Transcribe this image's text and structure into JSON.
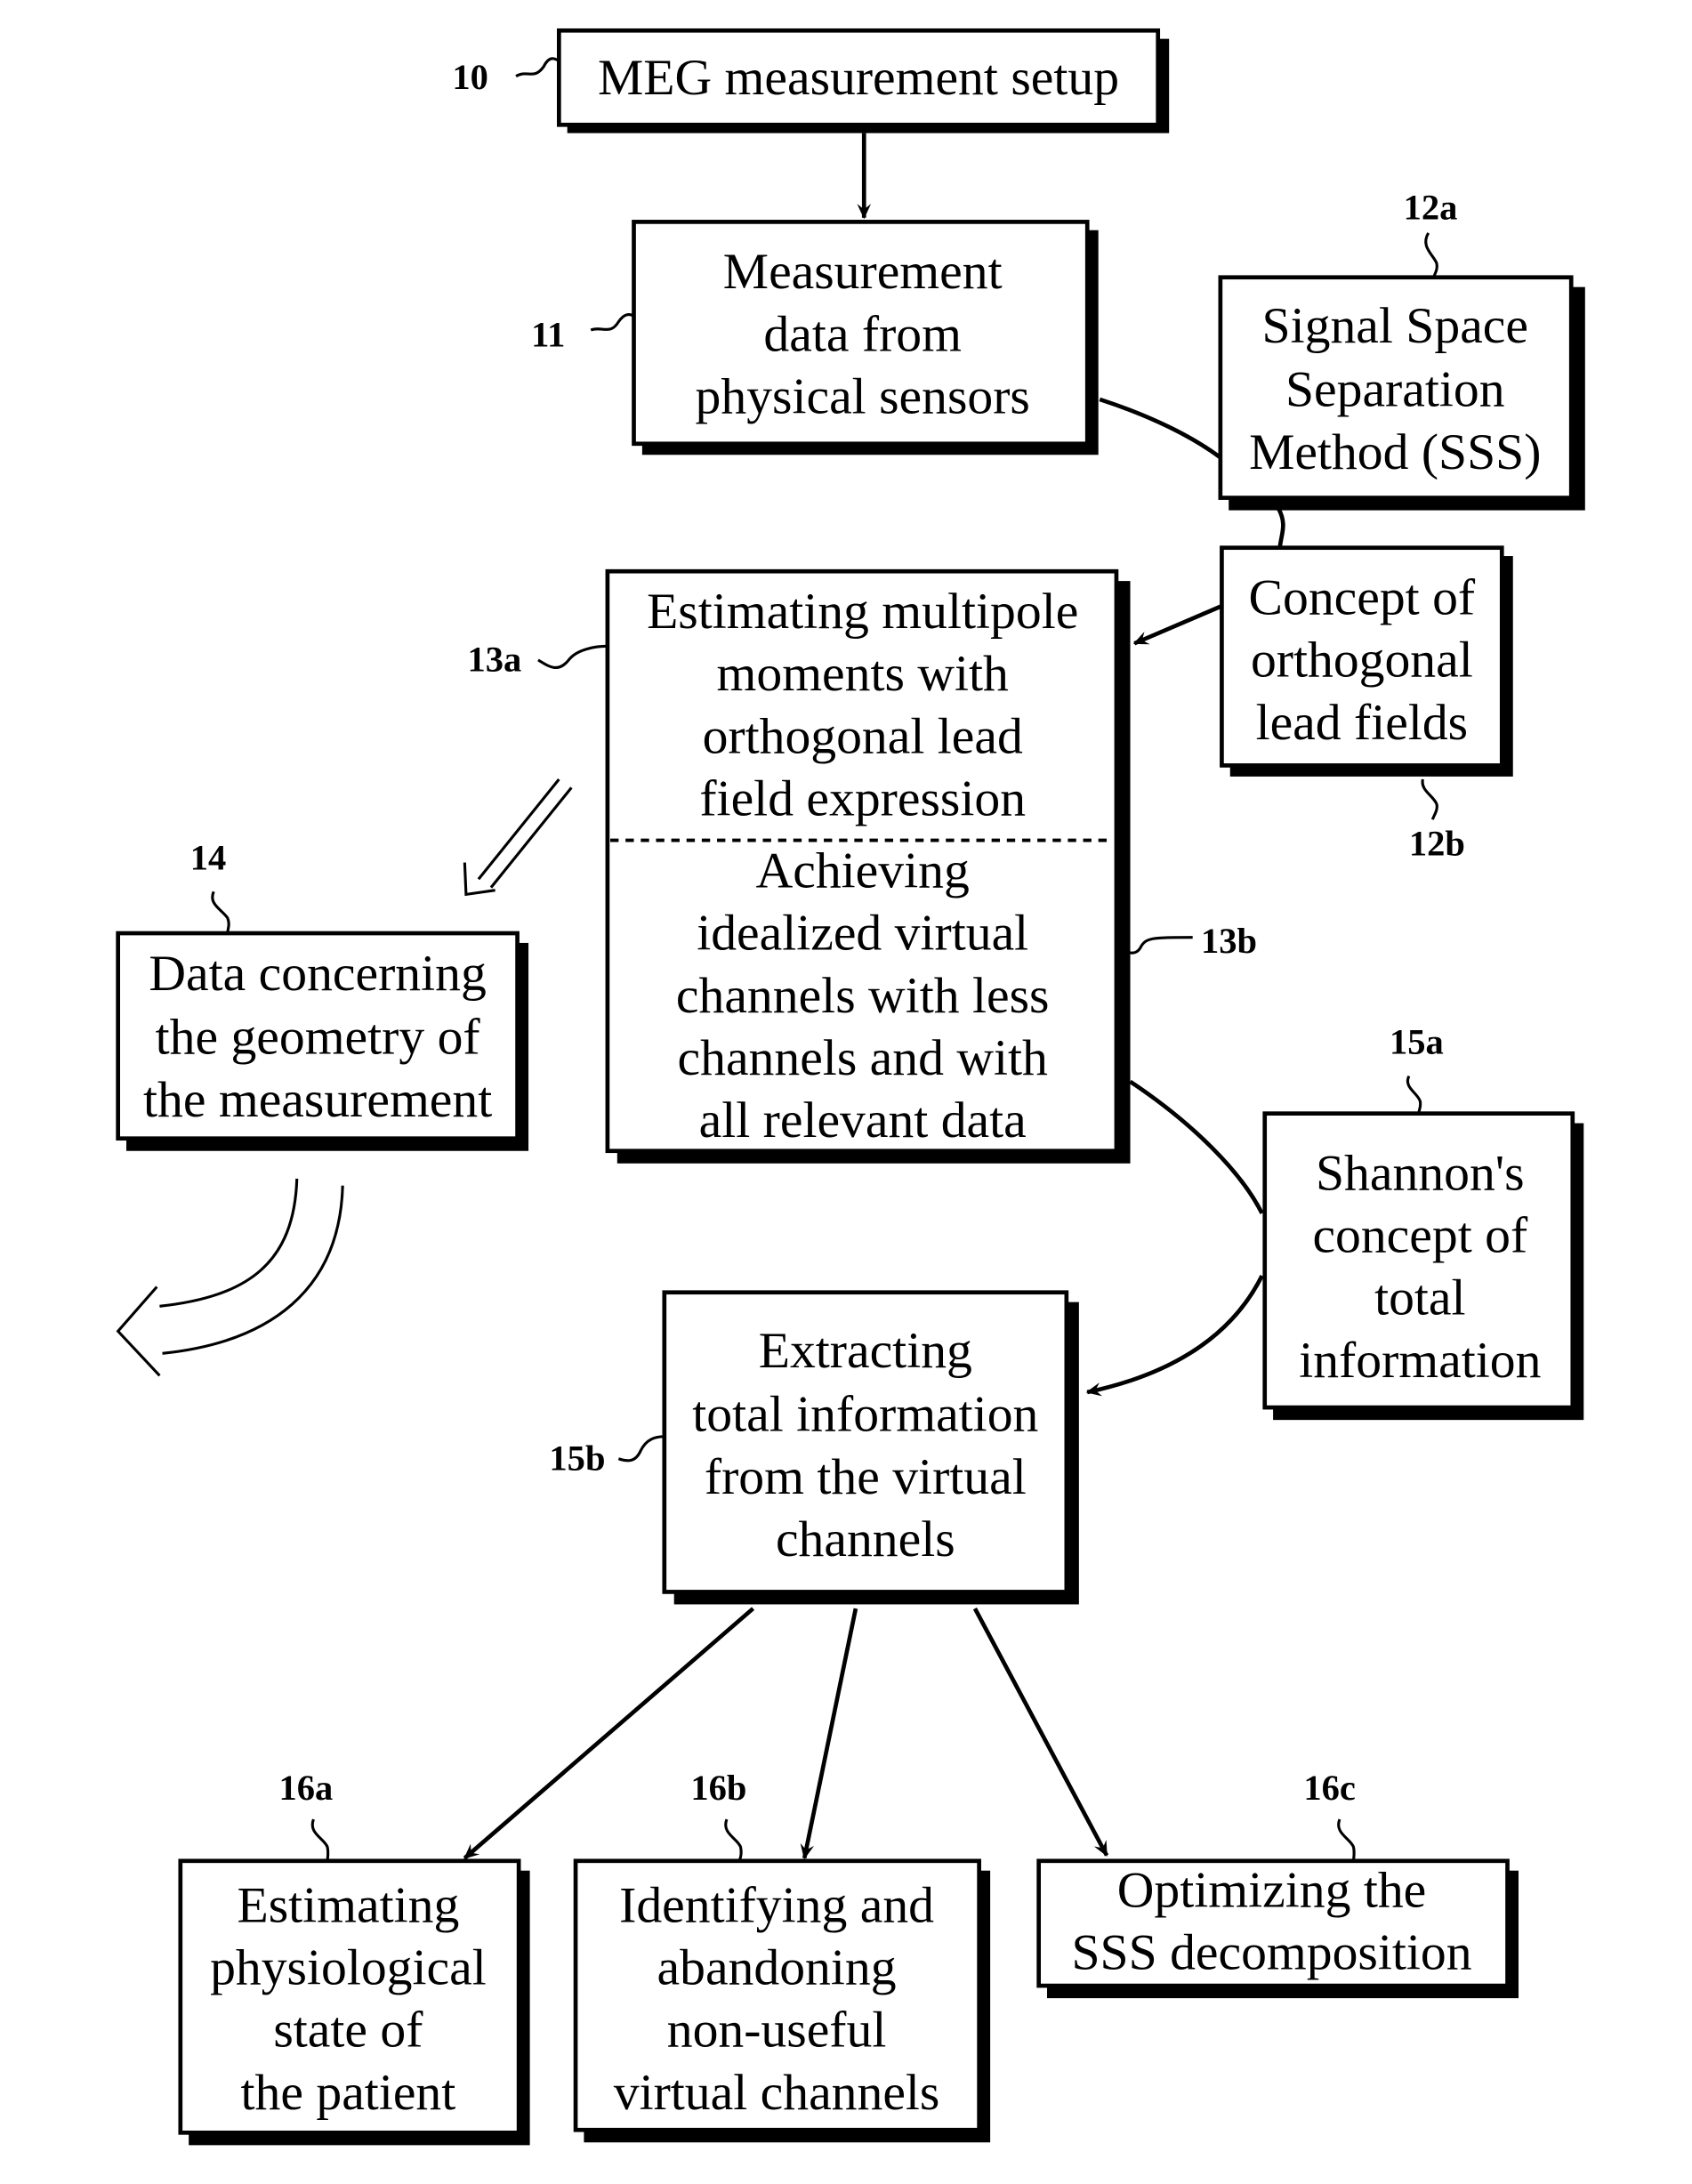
{
  "diagram": {
    "nodes": {
      "n10": {
        "ref": "10",
        "lines": [
          "MEG measurement setup"
        ]
      },
      "n11": {
        "ref": "11",
        "lines": [
          "Measurement",
          "data from",
          "physical sensors"
        ]
      },
      "n12a": {
        "ref": "12a",
        "lines": [
          "Signal Space",
          "Separation",
          "Method (SSS)"
        ]
      },
      "n12b": {
        "ref": "12b",
        "lines": [
          "Concept of",
          "orthogonal",
          "lead fields"
        ]
      },
      "n13a": {
        "ref": "13a",
        "lines": [
          "Estimating multipole",
          "moments with",
          "orthogonal lead",
          "field expression"
        ]
      },
      "n13b": {
        "ref": "13b",
        "lines": [
          "Achieving",
          "idealized virtual",
          "channels with less",
          "channels and with",
          "all relevant data"
        ]
      },
      "n14": {
        "ref": "14",
        "lines": [
          "Data concerning",
          "the geometry of",
          "the measurement"
        ]
      },
      "n15a": {
        "ref": "15a",
        "lines": [
          "Shannon's",
          "concept of",
          "total",
          "information"
        ]
      },
      "n15b": {
        "ref": "15b",
        "lines": [
          "Extracting",
          "total information",
          "from the virtual",
          "channels"
        ]
      },
      "n16a": {
        "ref": "16a",
        "lines": [
          "Estimating",
          "physiological",
          "state of",
          "the patient"
        ]
      },
      "n16b": {
        "ref": "16b",
        "lines": [
          "Identifying and",
          "abandoning",
          "non-useful",
          "virtual channels"
        ]
      },
      "n16c": {
        "ref": "16c",
        "lines": [
          "Optimizing the",
          "SSS decomposition"
        ]
      }
    },
    "edges": [
      {
        "from": "10",
        "to": "11",
        "type": "arrow"
      },
      {
        "from": "11",
        "to": "12a",
        "type": "connector"
      },
      {
        "from": "12a",
        "to": "12b",
        "type": "connector"
      },
      {
        "from": "12b",
        "to": "13a",
        "type": "arrow"
      },
      {
        "from": "13a",
        "to": "14",
        "type": "hollow-arrow"
      },
      {
        "from": "14",
        "to": "left",
        "type": "hollow-curved-arrow"
      },
      {
        "from": "13b",
        "to": "15a",
        "type": "connector"
      },
      {
        "from": "15a",
        "to": "15b",
        "type": "arrow"
      },
      {
        "from": "15b",
        "to": "16a",
        "type": "arrow"
      },
      {
        "from": "15b",
        "to": "16b",
        "type": "arrow"
      },
      {
        "from": "15b",
        "to": "16c",
        "type": "arrow"
      }
    ]
  }
}
